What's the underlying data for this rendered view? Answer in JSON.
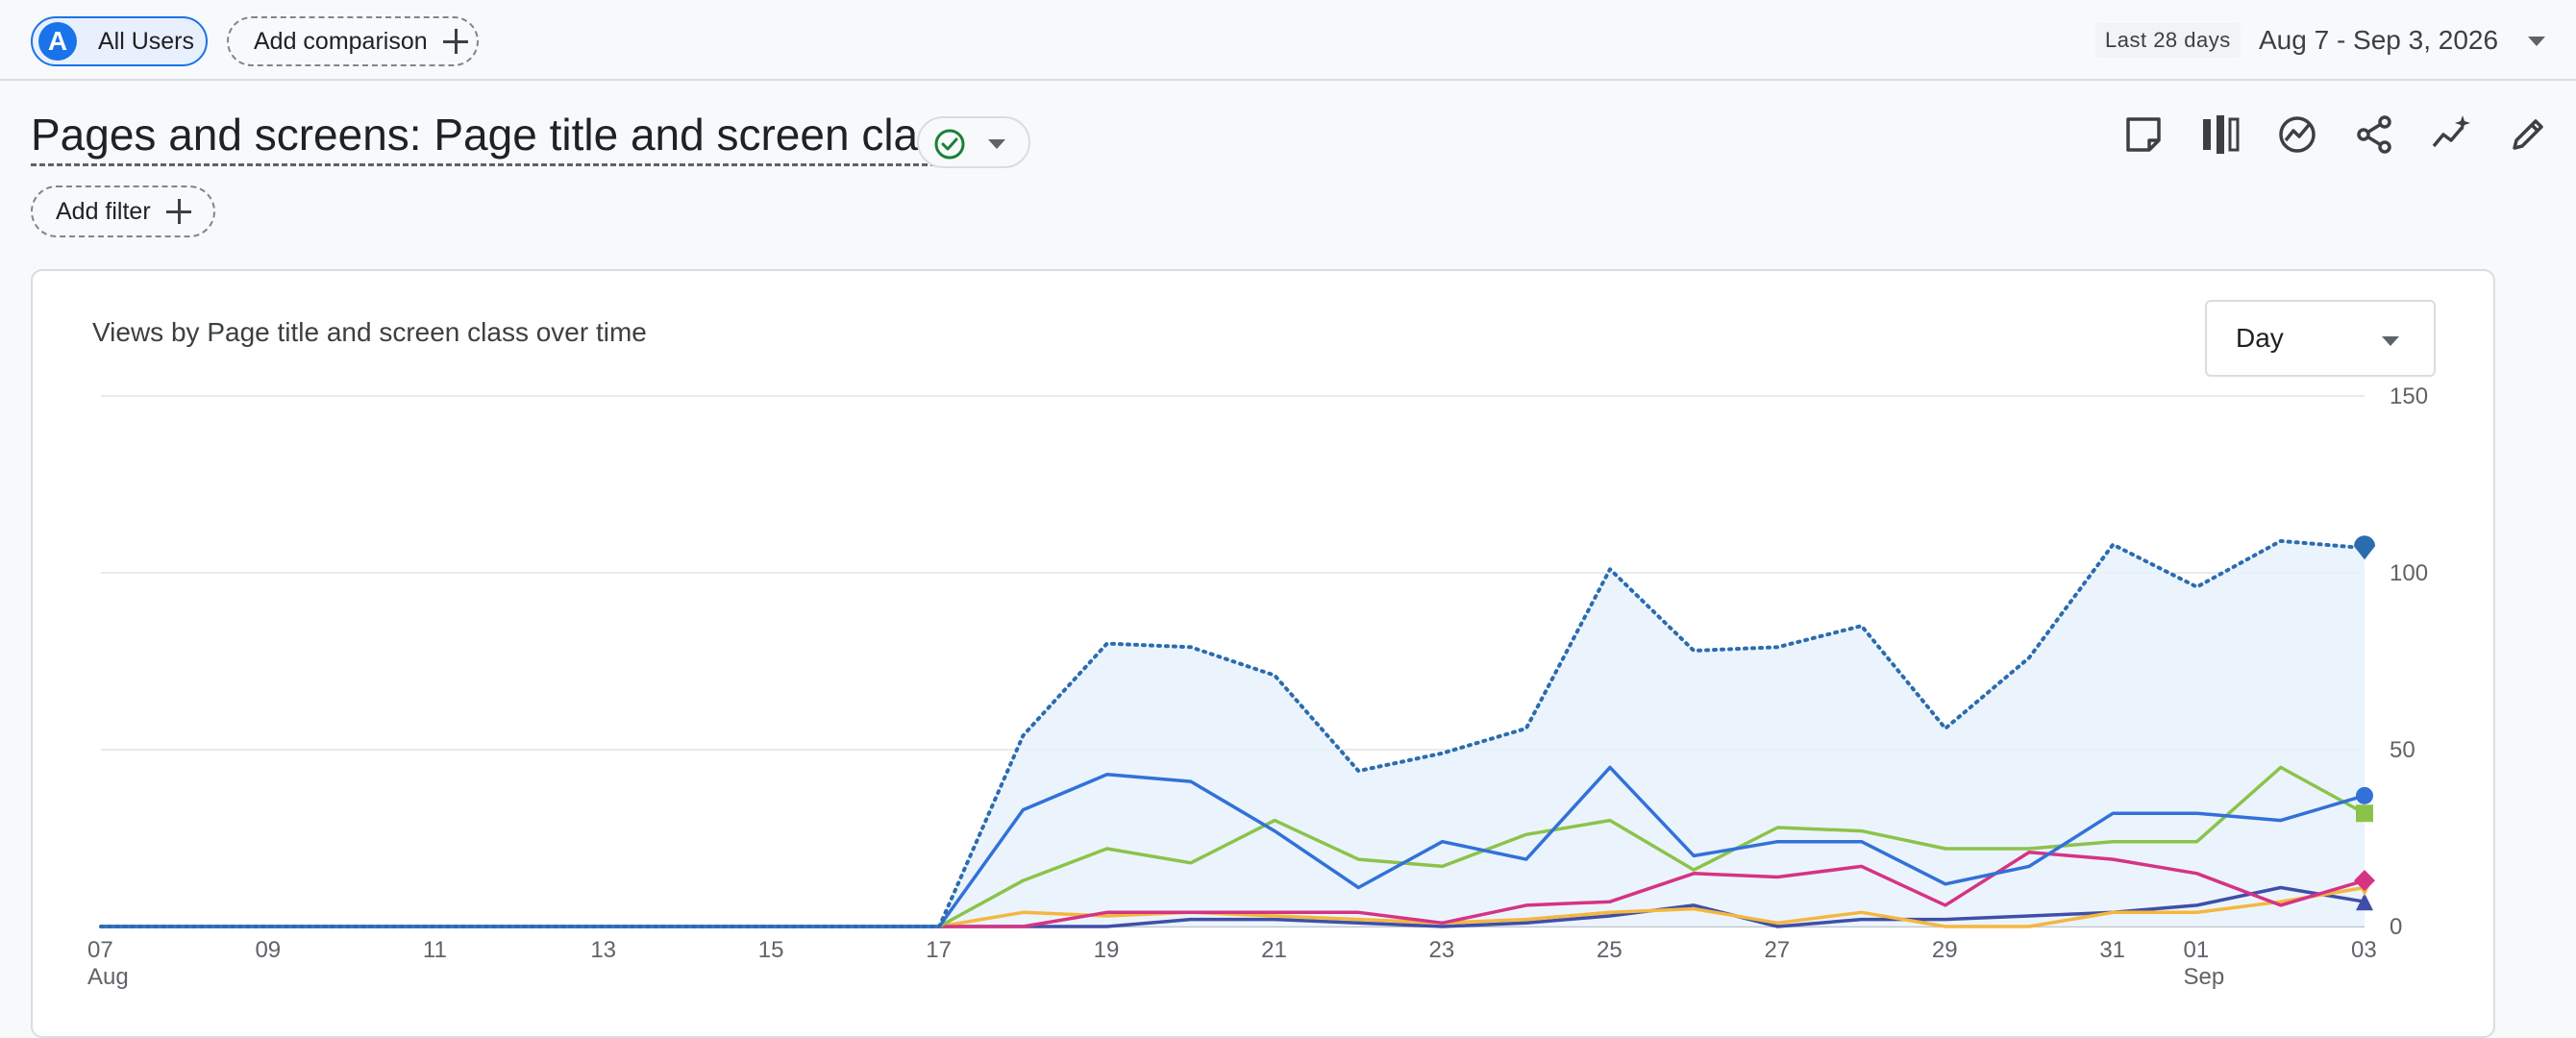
{
  "header": {
    "segment_avatar": "A",
    "segment_label": "All Users",
    "add_comparison_label": "Add comparison",
    "date_range_tag": "Last 28 days",
    "date_range": "Aug 7 - Sep 3, 2026"
  },
  "report": {
    "title": "Pages and screens: Page title and screen class",
    "add_filter_label": "Add filter",
    "toolbar_icons": [
      "note-icon",
      "compare-columns-icon",
      "insights-icon",
      "share-icon",
      "sparkle-insights-icon",
      "edit-icon"
    ]
  },
  "card": {
    "title": "Views by Page title and screen class over time",
    "granularity": "Day"
  },
  "chart_data": {
    "type": "line",
    "title": "Views by Page title and screen class over time",
    "x": [
      "Aug 7",
      "Aug 8",
      "Aug 9",
      "Aug 10",
      "Aug 11",
      "Aug 12",
      "Aug 13",
      "Aug 14",
      "Aug 15",
      "Aug 16",
      "Aug 17",
      "Aug 18",
      "Aug 19",
      "Aug 20",
      "Aug 21",
      "Aug 22",
      "Aug 23",
      "Aug 24",
      "Aug 25",
      "Aug 26",
      "Aug 27",
      "Aug 28",
      "Aug 29",
      "Aug 30",
      "Aug 31",
      "Sep 1",
      "Sep 2",
      "Sep 3"
    ],
    "x_ticks": [
      {
        "x": "Aug 7",
        "label": "07",
        "sublabel": "Aug"
      },
      {
        "x": "Aug 9",
        "label": "09"
      },
      {
        "x": "Aug 11",
        "label": "11"
      },
      {
        "x": "Aug 13",
        "label": "13"
      },
      {
        "x": "Aug 15",
        "label": "15"
      },
      {
        "x": "Aug 17",
        "label": "17"
      },
      {
        "x": "Aug 19",
        "label": "19"
      },
      {
        "x": "Aug 21",
        "label": "21"
      },
      {
        "x": "Aug 23",
        "label": "23"
      },
      {
        "x": "Aug 25",
        "label": "25"
      },
      {
        "x": "Aug 27",
        "label": "27"
      },
      {
        "x": "Aug 29",
        "label": "29"
      },
      {
        "x": "Aug 31",
        "label": "31"
      },
      {
        "x": "Sep 1",
        "label": "01",
        "sublabel": "Sep"
      },
      {
        "x": "Sep 3",
        "label": "03"
      }
    ],
    "ylim": [
      0,
      150
    ],
    "y_ticks": [
      0,
      50,
      100,
      150
    ],
    "y_axis_side": "right",
    "grid": true,
    "series": [
      {
        "key": "total",
        "color": "#2b6cb0",
        "style": "dotted",
        "area": true,
        "marker": "pin",
        "values": [
          0,
          0,
          0,
          0,
          0,
          0,
          0,
          0,
          0,
          0,
          0,
          54,
          80,
          79,
          71,
          44,
          49,
          56,
          101,
          78,
          79,
          85,
          56,
          76,
          108,
          96,
          109,
          107
        ]
      },
      {
        "key": "s1",
        "color": "#3271d8",
        "style": "solid",
        "marker": "circle",
        "values": [
          0,
          0,
          0,
          0,
          0,
          0,
          0,
          0,
          0,
          0,
          0,
          33,
          43,
          41,
          27,
          11,
          24,
          19,
          45,
          20,
          24,
          24,
          12,
          17,
          32,
          32,
          30,
          37
        ]
      },
      {
        "key": "s2",
        "color": "#8bc34a",
        "style": "solid",
        "marker": "square",
        "values": [
          0,
          0,
          0,
          0,
          0,
          0,
          0,
          0,
          0,
          0,
          0,
          13,
          22,
          18,
          30,
          19,
          17,
          26,
          30,
          16,
          28,
          27,
          22,
          22,
          24,
          24,
          45,
          32
        ]
      },
      {
        "key": "s3",
        "color": "#d63384",
        "style": "solid",
        "marker": "diamond",
        "values": [
          0,
          0,
          0,
          0,
          0,
          0,
          0,
          0,
          0,
          0,
          0,
          0,
          4,
          4,
          4,
          4,
          1,
          6,
          7,
          15,
          14,
          17,
          6,
          21,
          19,
          15,
          6,
          13
        ]
      },
      {
        "key": "s4",
        "color": "#f4b73e",
        "style": "solid",
        "marker": "triangle-down",
        "values": [
          0,
          0,
          0,
          0,
          0,
          0,
          0,
          0,
          0,
          0,
          0,
          4,
          3,
          4,
          3,
          2,
          1,
          2,
          4,
          5,
          1,
          4,
          0,
          0,
          4,
          4,
          7,
          11
        ]
      },
      {
        "key": "s5",
        "color": "#3f4fa8",
        "style": "solid",
        "marker": "triangle-up",
        "values": [
          0,
          0,
          0,
          0,
          0,
          0,
          0,
          0,
          0,
          0,
          0,
          0,
          0,
          2,
          2,
          1,
          0,
          1,
          3,
          6,
          0,
          2,
          2,
          3,
          4,
          6,
          11,
          7
        ]
      }
    ]
  }
}
